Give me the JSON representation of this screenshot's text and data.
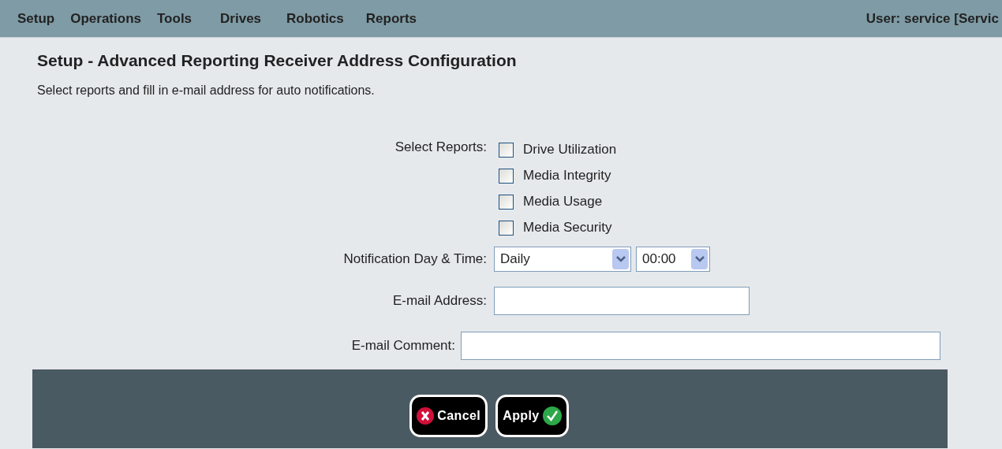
{
  "menu": [
    {
      "label": "Setup"
    },
    {
      "label": "Operations"
    },
    {
      "label": "Tools"
    },
    {
      "label": "Drives"
    },
    {
      "label": "Robotics"
    },
    {
      "label": "Reports"
    }
  ],
  "user": "User: service [Servic",
  "title": "Setup - Advanced Reporting Receiver Address Configuration",
  "subtitle": "Select reports and fill in e-mail address for auto notifications.",
  "reports": {
    "label": "Select Reports:",
    "options": [
      {
        "label": "Drive Utilization",
        "checked": false
      },
      {
        "label": "Media Integrity",
        "checked": false
      },
      {
        "label": "Media Usage",
        "checked": false
      },
      {
        "label": "Media Security",
        "checked": false
      }
    ]
  },
  "notification": {
    "label": "Notification Day & Time:",
    "day": "Daily",
    "time": "00:00"
  },
  "email_address": {
    "label": "E-mail Address:"
  },
  "email_comment": {
    "label": "E-mail Comment:"
  },
  "buttons": [
    {
      "kind": "cancel",
      "label": "Cancel"
    },
    {
      "kind": "apply",
      "label": "Apply"
    }
  ]
}
